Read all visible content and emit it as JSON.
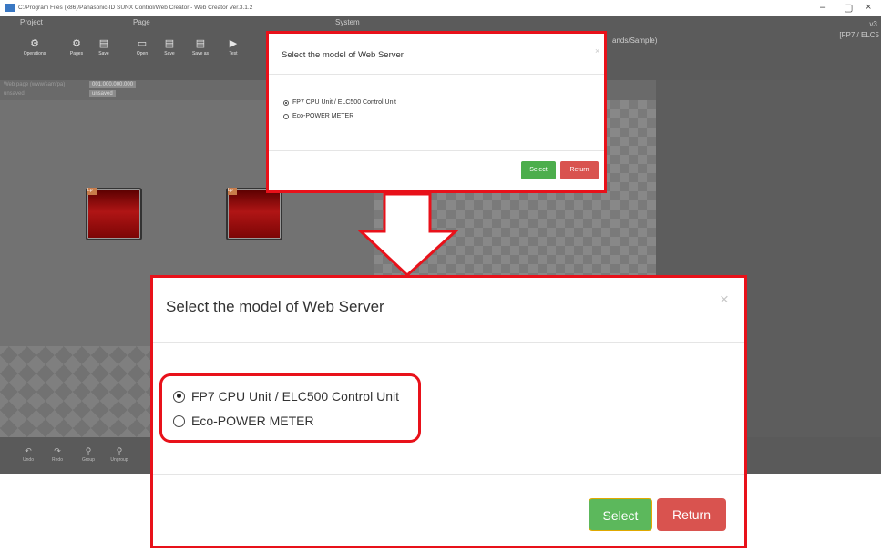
{
  "app": {
    "window_title": "C:/Program Files (x86)/Panasonic-ID SUNX Control/Web Creator - Web Creator Ver.3.1.2",
    "window_controls": {
      "minimize": "–",
      "maximize": "▢",
      "close": "×"
    },
    "ribbon": {
      "groups": {
        "project": "Project",
        "page": "Page",
        "system": "System"
      },
      "project_buttons": [
        {
          "label": "Operations",
          "icon": "gear-icon",
          "glyph": "⚙"
        },
        {
          "label": "Pages",
          "icon": "settings-icon",
          "glyph": "⚙"
        },
        {
          "label": "Save",
          "icon": "save-icon",
          "glyph": "▤"
        }
      ],
      "page_buttons": [
        {
          "label": "Open",
          "icon": "new-page-icon",
          "glyph": "▭"
        },
        {
          "label": "Save",
          "icon": "save-icon",
          "glyph": "▤"
        },
        {
          "label": "Save as",
          "icon": "save-as-icon",
          "glyph": "▤"
        },
        {
          "label": "Test",
          "icon": "play-icon",
          "glyph": "▶"
        }
      ],
      "project_path": "ands/Sample)",
      "version": "v3.",
      "model": "[FP7 / ELC5"
    },
    "tabs": [
      {
        "label": "Web page (www/sam/pa)",
        "active": false
      },
      {
        "label": "001.000.000.000",
        "active": true
      },
      {
        "label": "unsaved",
        "active": false
      },
      {
        "label": "unsaved",
        "active": true
      }
    ],
    "bottom_buttons": [
      {
        "label": "Undo",
        "icon": "undo-icon",
        "glyph": "↶"
      },
      {
        "label": "Redo",
        "icon": "redo-icon",
        "glyph": "↷"
      },
      {
        "label": "Group",
        "icon": "group-icon",
        "glyph": "⚲"
      },
      {
        "label": "Ungroup",
        "icon": "ungroup-icon",
        "glyph": "⚲"
      }
    ],
    "lamp_tags": [
      "Lp",
      "Lp"
    ]
  },
  "small_dialog": {
    "title": "Select the model of Web Server",
    "close": "×",
    "options": [
      {
        "label": "FP7 CPU Unit / ELC500 Control Unit",
        "selected": true
      },
      {
        "label": "Eco-POWER METER",
        "selected": false
      }
    ],
    "select_label": "Select",
    "return_label": "Return"
  },
  "big_dialog": {
    "title": "Select the model of Web Server",
    "close": "×",
    "options": [
      {
        "label": "FP7 CPU Unit / ELC500 Control Unit",
        "selected": true
      },
      {
        "label": "Eco-POWER METER",
        "selected": false
      }
    ],
    "select_label": "Select",
    "return_label": "Return"
  },
  "colors": {
    "highlight": "#e8111a",
    "select_button": "#5cb85c",
    "return_button": "#d9534f"
  }
}
